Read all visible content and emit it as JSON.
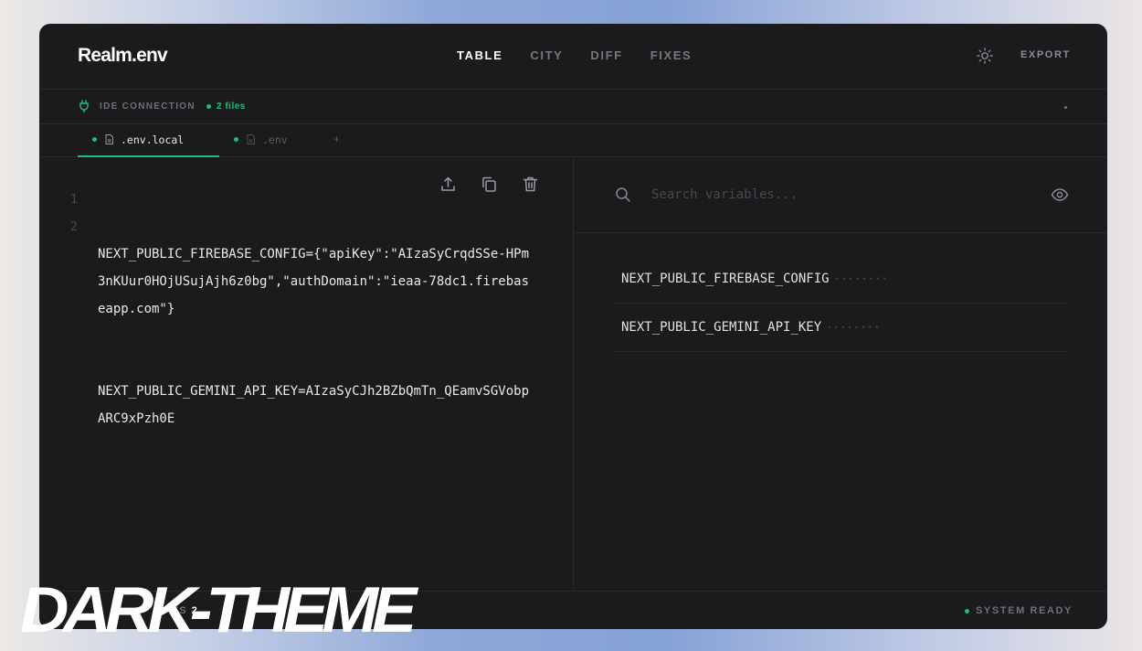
{
  "app": {
    "title": "Realm.env"
  },
  "nav": {
    "tabs": [
      {
        "label": "TABLE",
        "active": true
      },
      {
        "label": "CITY",
        "active": false
      },
      {
        "label": "DIFF",
        "active": false
      },
      {
        "label": "FIXES",
        "active": false
      }
    ],
    "theme_icon": "sun-icon",
    "export_label": "EXPORT"
  },
  "ide": {
    "label": "IDE CONNECTION",
    "files_count": "2 files"
  },
  "file_tabs": [
    {
      "label": ".env.local",
      "active": true
    },
    {
      "label": ".env",
      "active": false
    }
  ],
  "add_tab_label": "+",
  "editor": {
    "line_numbers": [
      "1",
      "2"
    ],
    "lines": [
      "NEXT_PUBLIC_FIREBASE_CONFIG={\"apiKey\":\"AIzaSyCrqdSSe-HPm3nKUur0HOjUSujAjh6z0bg\",\"authDomain\":\"ieaa-78dc1.firebaseapp.com\"}",
      "NEXT_PUBLIC_GEMINI_API_KEY=AIzaSyCJh2BZbQmTn_QEamvSGVobpARC9xPzh0E"
    ],
    "tools": [
      "upload-icon",
      "copy-icon",
      "trash-icon"
    ]
  },
  "search": {
    "placeholder": "Search variables..."
  },
  "variables": [
    {
      "name": "NEXT_PUBLIC_FIREBASE_CONFIG",
      "mask": "••••••••"
    },
    {
      "name": "NEXT_PUBLIC_GEMINI_API_KEY",
      "mask": "••••••••"
    }
  ],
  "status": {
    "left_label": "TS",
    "left_count": "2",
    "ready_label": "SYSTEM READY"
  },
  "banner": {
    "text": "DARK-THEME"
  },
  "colors": {
    "accent": "#1fbf7a",
    "window_bg": "#1b1b1d"
  }
}
